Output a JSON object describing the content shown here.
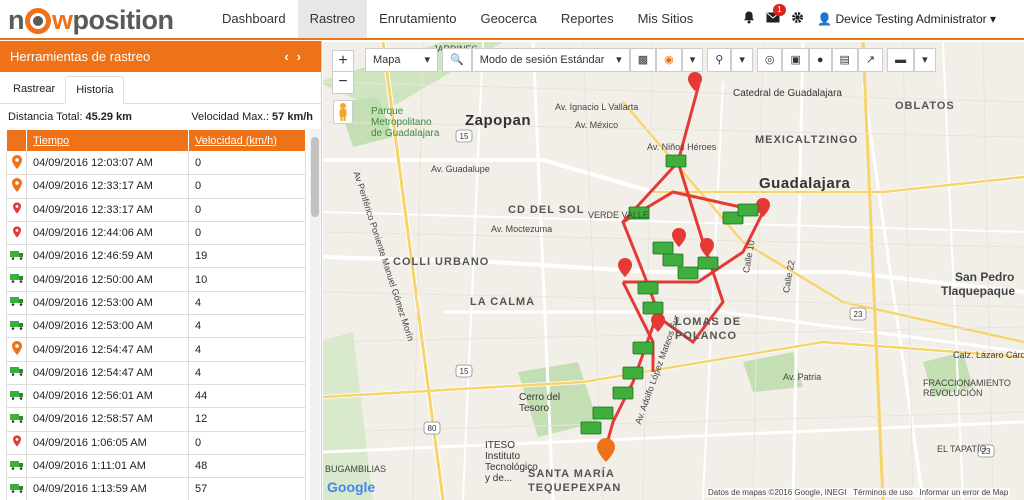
{
  "logo": {
    "text_a": "n",
    "text_b": "w",
    "text_c": "position"
  },
  "nav": {
    "items": [
      "Dashboard",
      "Rastreo",
      "Enrutamiento",
      "Geocerca",
      "Reportes",
      "Mis Sitios"
    ],
    "active": "Rastreo",
    "notification_count": "1",
    "user": "Device Testing Administrator"
  },
  "panel": {
    "title": "Herramientas de rastreo",
    "tabs": [
      "Rastrear",
      "Historia"
    ],
    "active_tab": "Historia",
    "distance_label": "Distancia Total:",
    "distance_value": "45.29 km",
    "speed_label": "Velocidad Max.:",
    "speed_value": "57 km/h",
    "columns": [
      "Tiempo",
      "Velocidad (km/h)"
    ],
    "rows": [
      {
        "icon": "orange-pin-icon",
        "time": "04/09/2016 12:03:07 AM",
        "speed": "0"
      },
      {
        "icon": "orange-pin-icon",
        "time": "04/09/2016 12:33:17 AM",
        "speed": "0"
      },
      {
        "icon": "red-pin-icon",
        "time": "04/09/2016 12:33:17 AM",
        "speed": "0"
      },
      {
        "icon": "red-pin-icon",
        "time": "04/09/2016 12:44:06 AM",
        "speed": "0"
      },
      {
        "icon": "truck-icon",
        "time": "04/09/2016 12:46:59 AM",
        "speed": "19"
      },
      {
        "icon": "truck-icon",
        "time": "04/09/2016 12:50:00 AM",
        "speed": "10"
      },
      {
        "icon": "truck-icon",
        "time": "04/09/2016 12:53:00 AM",
        "speed": "4"
      },
      {
        "icon": "truck-icon",
        "time": "04/09/2016 12:53:00 AM",
        "speed": "4"
      },
      {
        "icon": "orange-pin-icon",
        "time": "04/09/2016 12:54:47 AM",
        "speed": "4"
      },
      {
        "icon": "truck-icon",
        "time": "04/09/2016 12:54:47 AM",
        "speed": "4"
      },
      {
        "icon": "truck-icon",
        "time": "04/09/2016 12:56:01 AM",
        "speed": "44"
      },
      {
        "icon": "truck-icon",
        "time": "04/09/2016 12:58:57 AM",
        "speed": "12"
      },
      {
        "icon": "red-pin-icon",
        "time": "04/09/2016 1:06:05 AM",
        "speed": "0"
      },
      {
        "icon": "truck-icon",
        "time": "04/09/2016 1:11:01 AM",
        "speed": "48"
      },
      {
        "icon": "truck-icon",
        "time": "04/09/2016 1:13:59 AM",
        "speed": "57"
      }
    ]
  },
  "map": {
    "type_select": "Mapa",
    "session_select": "Modo de sesión Estándar",
    "zoom_in": "+",
    "zoom_out": "−",
    "google": "Google",
    "attribution": [
      "Datos de mapas ©2016 Google, INEGI",
      "Términos de uso",
      "Informar un error de Map"
    ],
    "labels": {
      "zapopan": "Zapopan",
      "guadalajara": "Guadalajara",
      "oblatos": "OBLATOS",
      "mexicaltzingo": "MEXICALTZINGO",
      "cd_del_sol": "CD DEL SOL",
      "colli_urbano": "COLLI URBANO",
      "la_calma": "LA CALMA",
      "lomas": "LOMAS DE",
      "polanco": "POLANCO",
      "san_pedro": "San Pedro",
      "tlaquepaque": "Tlaquepaque",
      "santa_maria": "SANTA MARÍA",
      "tequepexpan": "TEQUEPEXPAN",
      "catedral": "Catedral de Guadalajara",
      "parque": "Parque Metropolitano de Guadalajara",
      "cerro": "Cerro del Tesoro",
      "iteso": "ITESO Instituto Tecnológico y de...",
      "bugambilias": "BUGAMBILIAS",
      "revolucion": "FRACCIONAMIENTO REVOLUCIÓN",
      "tapatio": "EL TAPATÍO",
      "verde_valle": "VERDE VALLE",
      "jardines": "JARDINES",
      "av_lopez_mateos": "Av. Adolfo López Mateos Sur",
      "periferico": "Av Periférico Poniente Manuel Gómez Morín",
      "lazaro": "Calz. Lázaro Cárdenas",
      "patria": "Av. Patria",
      "guadalupe": "Av. Guadalupe",
      "moctezuma": "Av. Moctezuma",
      "mexico": "Av. México",
      "vallarta": "Av. Ignacio L Vallarta",
      "ninos_heroes": "Av. Niños Héroes",
      "calle10": "Calle 10",
      "calle22": "Calle 22",
      "shield_15a": "15",
      "shield_15b": "15",
      "shield_80": "80",
      "shield_23a": "23",
      "shield_23b": "23"
    }
  },
  "colors": {
    "accent": "#ee7218",
    "route": "#e53935",
    "truck": "#3fae3c"
  }
}
